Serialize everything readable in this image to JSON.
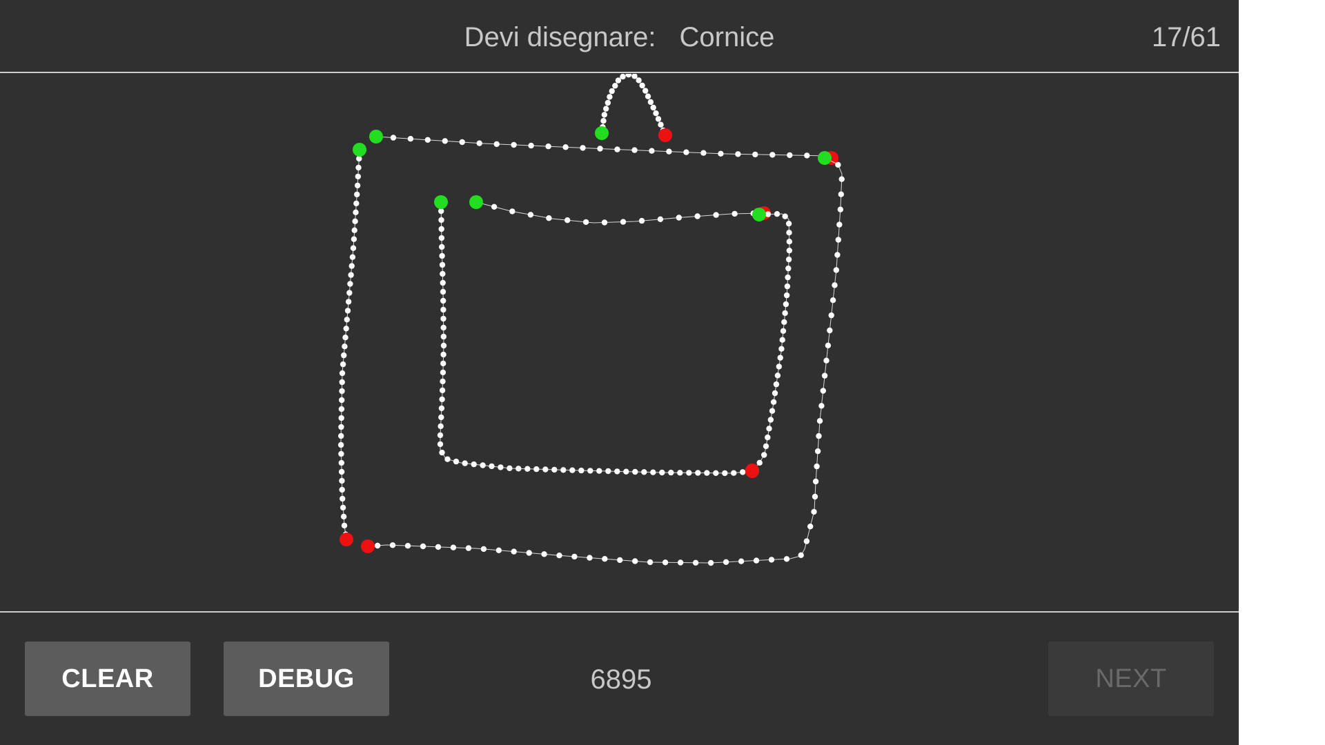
{
  "header": {
    "prompt_label": "Devi disegnare:",
    "target_word": "Cornice",
    "progress": "17/61"
  },
  "toolbar": {
    "clear_label": "CLEAR",
    "debug_label": "DEBUG",
    "score": "6895",
    "next_label": "NEXT"
  },
  "colors": {
    "background": "#303030",
    "stroke": "#ffffff",
    "stroke_start": "#22dd22",
    "stroke_end": "#ee1111",
    "button": "#5c5c5c",
    "button_disabled": "#3a3a3a"
  },
  "drawing": {
    "stroke_count": 7,
    "start_marker_icon": "green-dot-icon",
    "end_marker_icon": "red-dot-icon"
  }
}
